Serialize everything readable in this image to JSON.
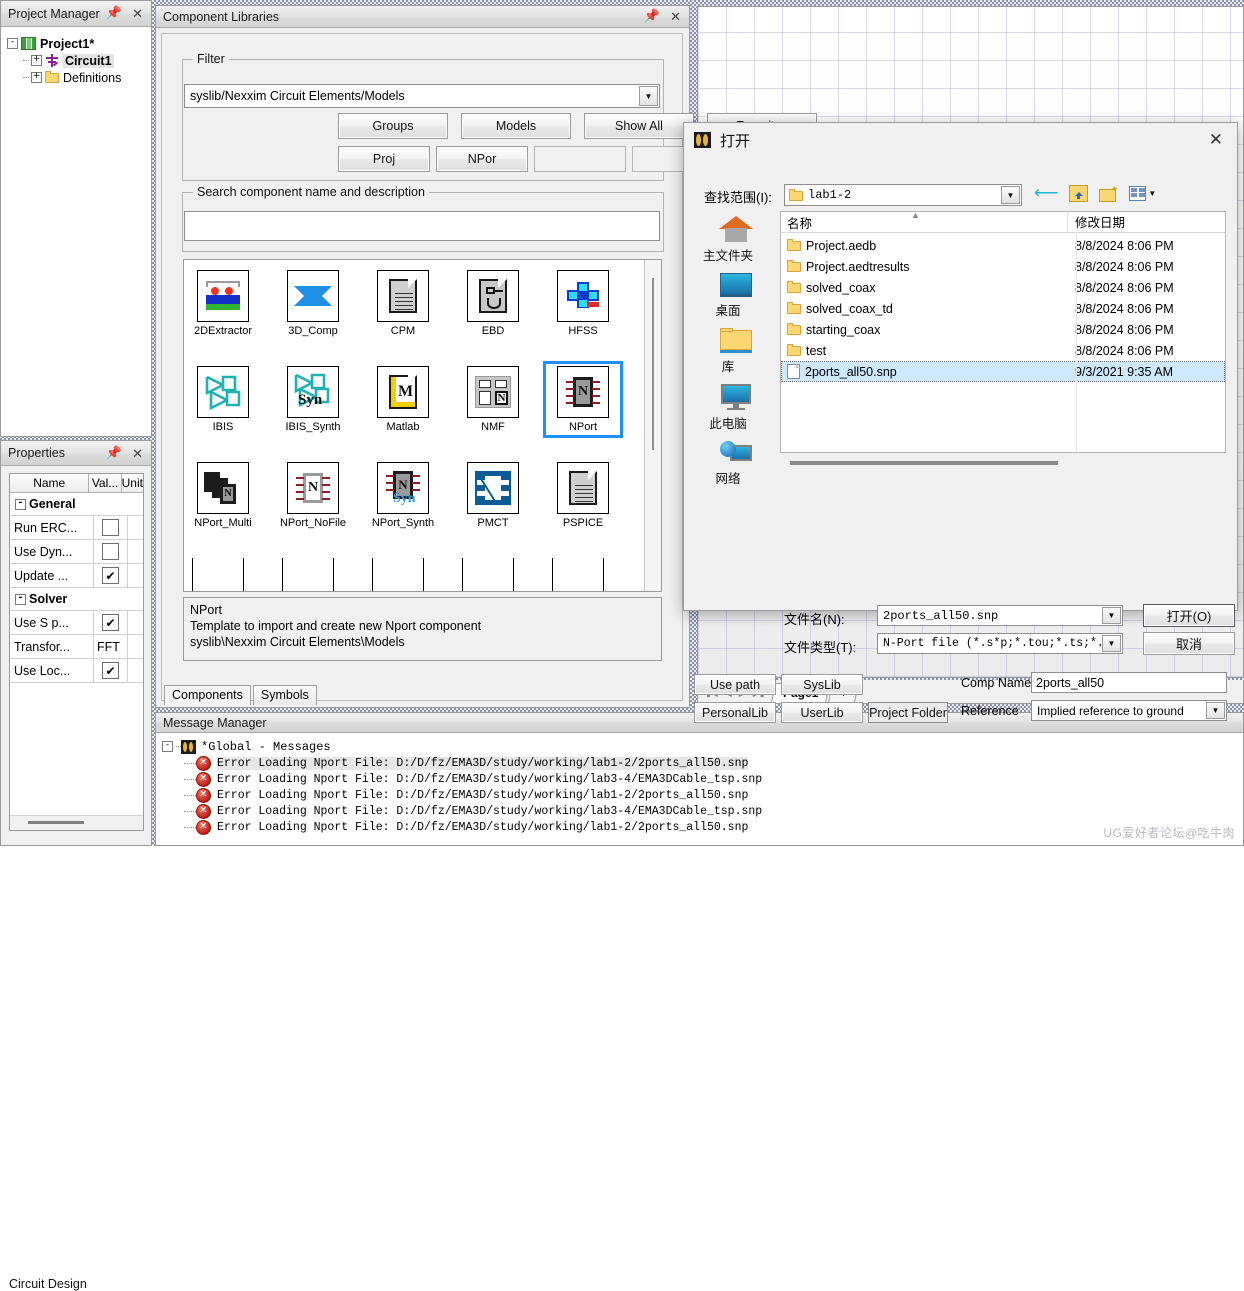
{
  "project_manager": {
    "title": "Project Manager",
    "pin_icon": "pin-icon",
    "close_icon": "close-icon",
    "nodes": [
      {
        "label": "Project1*",
        "icon": "project-icon",
        "expander": "-"
      },
      {
        "label": "Circuit1",
        "icon": "circuit-icon",
        "expander": "+"
      },
      {
        "label": "Definitions",
        "icon": "folder-icon",
        "expander": "+"
      }
    ]
  },
  "properties": {
    "title": "Properties",
    "pin_icon": "pin-icon",
    "close_icon": "close-icon",
    "columns": [
      "Name",
      "Val...",
      "Unit"
    ],
    "groups": [
      {
        "name": "General",
        "expander": "-",
        "rows": [
          {
            "name": "Run ERC...",
            "value": "",
            "checkbox": false,
            "unit": ""
          },
          {
            "name": "Use Dyn...",
            "value": "",
            "checkbox": false,
            "unit": ""
          },
          {
            "name": "Update ...",
            "value": "",
            "checkbox": true,
            "unit": ""
          }
        ]
      },
      {
        "name": "Solver",
        "expander": "-",
        "rows": [
          {
            "name": "Use S p...",
            "value": "",
            "checkbox": true,
            "unit": ""
          },
          {
            "name": "Transfor...",
            "value": "FFT",
            "checkbox": null,
            "unit": ""
          },
          {
            "name": "Use Loc...",
            "value": "",
            "checkbox": true,
            "unit": ""
          }
        ]
      }
    ],
    "bottom_tab": "Circuit Design"
  },
  "component_libraries": {
    "title": "Component Libraries",
    "pin_icon": "pin-icon",
    "close_icon": "close-icon",
    "filter": {
      "legend": "Filter",
      "path_value": "syslib/Nexxim Circuit Elements/Models",
      "dropdown_icon": "chevron-down-icon",
      "buttons_row1": [
        "Groups",
        "Models",
        "Show All",
        "Favorites"
      ],
      "buttons_row2": [
        "Proj",
        "NPor",
        "",
        "",
        ""
      ]
    },
    "search": {
      "legend": "Search component name and description",
      "value": "",
      "placeholder": ""
    },
    "components": [
      {
        "label": "2DExtractor",
        "icon": "extractor-icon",
        "selected": false
      },
      {
        "label": "3D_Comp",
        "icon": "diamond-icon",
        "selected": false
      },
      {
        "label": "CPM",
        "icon": "document-icon",
        "selected": false
      },
      {
        "label": "EBD",
        "icon": "ebd-doc-icon",
        "selected": false
      },
      {
        "label": "HFSS",
        "icon": "hfss-icon",
        "selected": false
      },
      {
        "label": "IBIS",
        "icon": "ibis-icon",
        "selected": false
      },
      {
        "label": "IBIS_Synth",
        "icon": "ibis-synth-icon",
        "selected": false
      },
      {
        "label": "Matlab",
        "icon": "matlab-icon",
        "selected": false
      },
      {
        "label": "NMF",
        "icon": "nmf-icon",
        "selected": false
      },
      {
        "label": "NPort",
        "icon": "nport-chip-icon",
        "selected": true
      },
      {
        "label": "NPort_Multi",
        "icon": "nport-multi-icon",
        "selected": false
      },
      {
        "label": "NPort_NoFile",
        "icon": "nport-nofile-icon",
        "selected": false
      },
      {
        "label": "NPort_Synth",
        "icon": "nport-synth-icon",
        "selected": false
      },
      {
        "label": "PMCT",
        "icon": "pmct-icon",
        "selected": false
      },
      {
        "label": "PSPICE",
        "icon": "document-icon",
        "selected": false
      }
    ],
    "description": {
      "line1": "NPort",
      "line2": "Template to import and create new Nport component",
      "line3": "syslib\\Nexxim Circuit Elements\\Models"
    },
    "tabs": [
      {
        "label": "Components",
        "active": true
      },
      {
        "label": "Symbols",
        "active": false
      }
    ]
  },
  "open_dialog": {
    "title": "打开",
    "app_icon": "app-icon",
    "close_icon": "close-icon",
    "lookin_label": "查找范围(I):",
    "lookin_value": "lab1-2",
    "lookin_icon": "folder-icon",
    "toolbar_icons": [
      "back-arrow-icon",
      "up-folder-icon",
      "new-folder-icon",
      "view-list-icon"
    ],
    "places": [
      {
        "label": "主文件夹",
        "icon": "home-icon"
      },
      {
        "label": "桌面",
        "icon": "desktop-icon"
      },
      {
        "label": "库",
        "icon": "library-folder-icon"
      },
      {
        "label": "此电脑",
        "icon": "this-pc-icon"
      },
      {
        "label": "网络",
        "icon": "network-icon"
      }
    ],
    "columns": {
      "name": "名称",
      "date": "修改日期",
      "sort_icon": "sort-asc-icon"
    },
    "files": [
      {
        "name": "Project.aedb",
        "date": "8/8/2024 8:06 PM",
        "type": "folder",
        "selected": false
      },
      {
        "name": "Project.aedtresults",
        "date": "8/8/2024 8:06 PM",
        "type": "folder",
        "selected": false
      },
      {
        "name": "solved_coax",
        "date": "8/8/2024 8:06 PM",
        "type": "folder",
        "selected": false
      },
      {
        "name": "solved_coax_td",
        "date": "8/8/2024 8:06 PM",
        "type": "folder",
        "selected": false
      },
      {
        "name": "starting_coax",
        "date": "8/8/2024 8:06 PM",
        "type": "folder",
        "selected": false
      },
      {
        "name": "test",
        "date": "8/8/2024 8:06 PM",
        "type": "folder",
        "selected": false
      },
      {
        "name": "2ports_all50.snp",
        "date": "9/3/2021 9:35 AM",
        "type": "file",
        "selected": true
      }
    ],
    "filename_label": "文件名(N):",
    "filename_value": "2ports_all50.snp",
    "filetype_label": "文件类型(T):",
    "filetype_value": "N-Port file (*.s*p;*.tou;*.ts;*.y*p;*",
    "open_button": "打开(O)",
    "cancel_button": "取消",
    "lib_buttons": [
      "Use path",
      "SysLib",
      "PersonalLib",
      "UserLib",
      "Project Folder"
    ],
    "comp_name_label": "Comp Name",
    "comp_name_value": "2ports_all50",
    "reference_label": "Reference",
    "reference_value": "Implied reference to ground"
  },
  "page_tabs": {
    "nav_icons": [
      "first-page-icon",
      "prev-page-icon",
      "next-page-icon",
      "last-page-icon"
    ],
    "tabs": [
      "Page1"
    ],
    "add_label": "+"
  },
  "message_manager": {
    "title": "Message Manager",
    "root": {
      "label": "*Global - Messages",
      "expander": "-",
      "icon": "global-icon"
    },
    "messages": [
      {
        "icon": "error-icon",
        "text": "Error Loading Nport File: D:/D/fz/EMA3D/study/working/lab1-2/2ports_all50.snp",
        "selected": true
      },
      {
        "icon": "error-icon",
        "text": "Error Loading Nport File: D:/D/fz/EMA3D/study/working/lab3-4/EMA3DCable_tsp.snp",
        "selected": false
      },
      {
        "icon": "error-icon",
        "text": "Error Loading Nport File: D:/D/fz/EMA3D/study/working/lab1-2/2ports_all50.snp",
        "selected": false
      },
      {
        "icon": "error-icon",
        "text": "Error Loading Nport File: D:/D/fz/EMA3D/study/working/lab3-4/EMA3DCable_tsp.snp",
        "selected": false
      },
      {
        "icon": "error-icon",
        "text": "Error Loading Nport File: D:/D/fz/EMA3D/study/working/lab1-2/2ports_all50.snp",
        "selected": false
      }
    ]
  },
  "watermark": "UG爱好者论坛@吃牛肉",
  "colors": {
    "selection_blue": "#cde8ff",
    "focus_blue": "#1e90ff",
    "error_red": "#c01a10",
    "chrome_gray": "#f0f0f0"
  }
}
